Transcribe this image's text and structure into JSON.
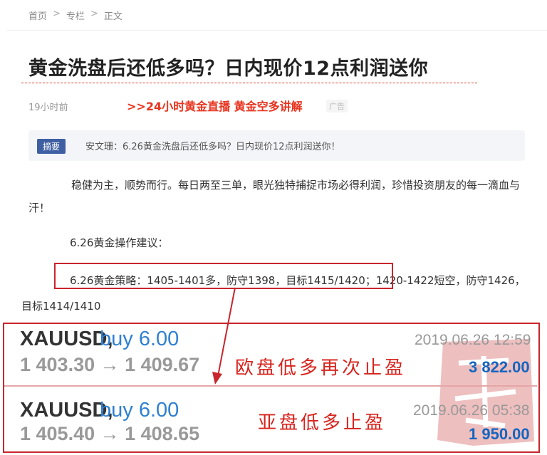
{
  "breadcrumb": {
    "home": "首页",
    "column": "专栏",
    "current": "正文",
    "sep": ">"
  },
  "article": {
    "title": "黄金洗盘后还低多吗？日内现价12点利润送你",
    "time_ago": "19小时前",
    "ad_link": ">>24小时黄金直播 黄金空多讲解",
    "ad_badge": "广告",
    "summary_tag": "摘要",
    "summary_text": "安文珊：6.26黄金洗盘后还低多吗？日内现价12点利润送你！",
    "para1": "稳健为主，顺势而行。每日两至三单，眼光独特捕捉市场必得利润，珍惜投资朋友的每一滴血与汗！",
    "para2": "6.26黄金操作建议：",
    "strategy_highlight": "6.26黄金策略：1405-1401多，防守1398，目标1415/1420",
    "strategy_rest": "；1420-1422短空，防守1426，目标1414/1410"
  },
  "trades": [
    {
      "symbol": "XAUUSD,",
      "side": "buy 6.00",
      "prices": "1 403.30 → 1 409.67",
      "time": "2019.06.26 12:59",
      "profit": "3 822.00",
      "note": "欧盘低多再次止盈"
    },
    {
      "symbol": "XAUUSD,",
      "side": "buy 6.00",
      "prices": "1 405.40 → 1 408.65",
      "time": "2019.06.26 05:38",
      "profit": "1 950.00",
      "note": "亚盘低多止盈"
    }
  ],
  "colors": {
    "accent_red": "#c9252c",
    "ad_red": "#e8331e",
    "buy_blue": "#2f80d1",
    "profit_blue": "#1565c0",
    "tag_blue": "#3f5fa3"
  },
  "icons": {
    "seal": "red-seal-stamp",
    "arrow": "red-pointer-arrow"
  }
}
